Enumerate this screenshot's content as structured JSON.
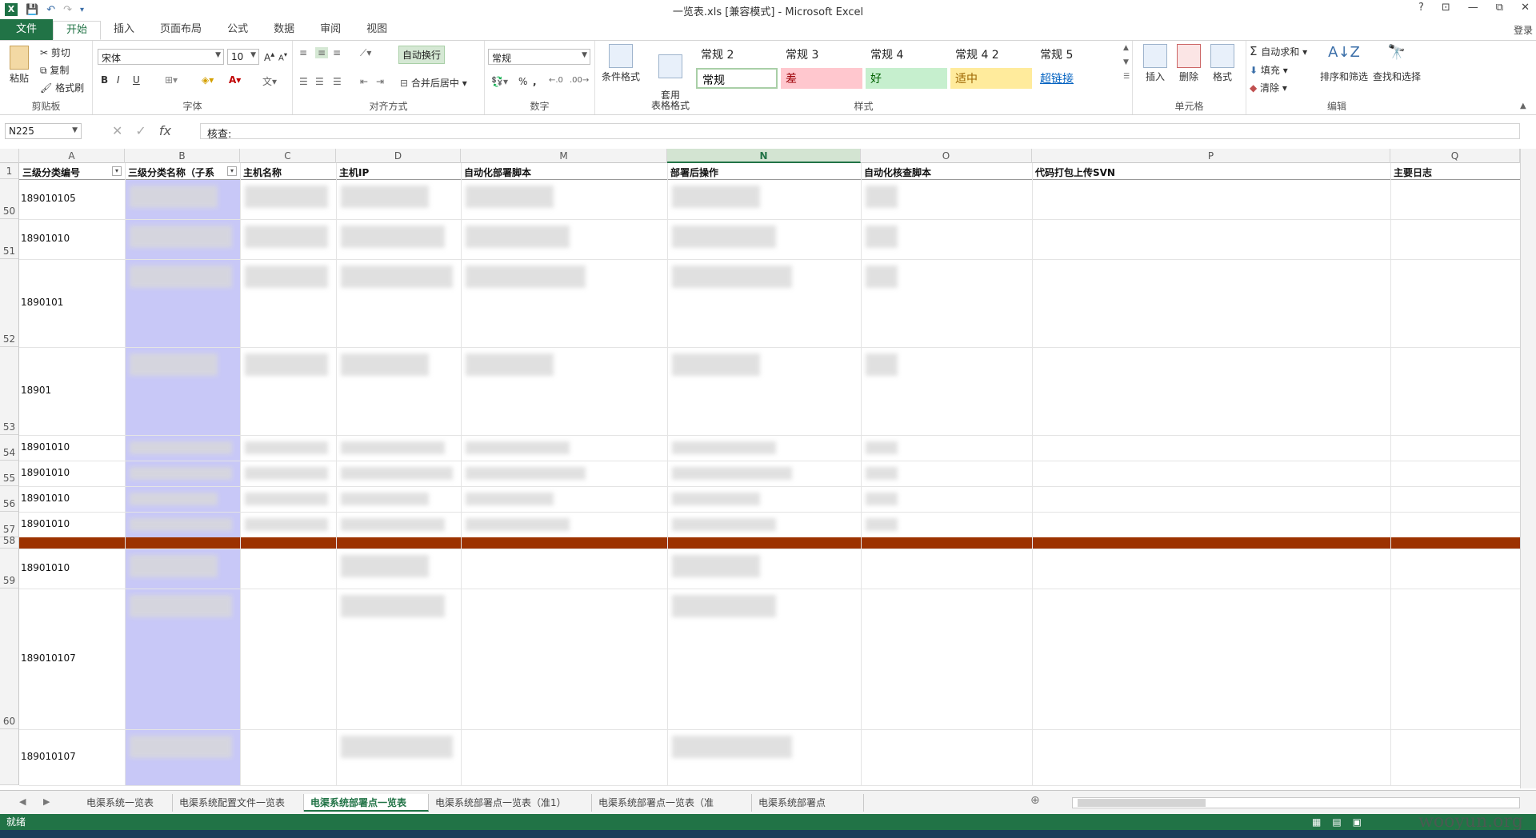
{
  "window": {
    "title": "一览表.xls  [兼容模式] - Microsoft Excel",
    "controls": [
      "?",
      "⊡",
      "—",
      "⧉",
      "✕"
    ],
    "signin": "登录"
  },
  "ribbon_tabs": [
    "文件",
    "开始",
    "插入",
    "页面布局",
    "公式",
    "数据",
    "审阅",
    "视图"
  ],
  "active_tab": "开始",
  "clipboard": {
    "paste": "粘贴",
    "cut": "剪切",
    "copy": "复制",
    "painter": "格式刷",
    "label": "剪贴板"
  },
  "font": {
    "name": "宋体",
    "size": "10",
    "bold": "B",
    "italic": "I",
    "underline": "U",
    "label": "字体"
  },
  "alignment": {
    "wrap": "自动换行",
    "merge": "合并后居中",
    "label": "对齐方式"
  },
  "number": {
    "format": "常规",
    "percent": "%",
    "comma": ",",
    "label": "数字"
  },
  "styles": {
    "conditional": "条件格式",
    "table": "套用\n表格格式",
    "top": [
      "常规 2",
      "常规 3",
      "常规 4",
      "常规 4 2",
      "常规 5"
    ],
    "bottom": [
      {
        "label": "常规",
        "bg": "#ffffff",
        "color": "#000000"
      },
      {
        "label": "差",
        "bg": "#ffc7ce",
        "color": "#9c0006"
      },
      {
        "label": "好",
        "bg": "#c6efce",
        "color": "#006100"
      },
      {
        "label": "适中",
        "bg": "#ffeb9c",
        "color": "#9c6500"
      },
      {
        "label": "超链接",
        "bg": "#ffffff",
        "color": "#0563c1"
      }
    ],
    "label": "样式"
  },
  "cells": {
    "insert": "插入",
    "delete": "删除",
    "format": "格式",
    "label": "单元格"
  },
  "editing": {
    "autosum": "自动求和",
    "fill": "填充",
    "clear": "清除",
    "sort": "排序和筛选",
    "find": "查找和选择",
    "label": "编辑"
  },
  "formula_bar": {
    "name_box": "N225",
    "content": "核查:"
  },
  "columns": [
    {
      "letter": "A",
      "header": "三级分类编号"
    },
    {
      "letter": "B",
      "header": "三级分类名称（子系"
    },
    {
      "letter": "C",
      "header": "主机名称"
    },
    {
      "letter": "D",
      "header": "主机IP"
    },
    {
      "letter": "M",
      "header": "自动化部署脚本"
    },
    {
      "letter": "N",
      "header": "部署后操作"
    },
    {
      "letter": "O",
      "header": "自动化核查脚本"
    },
    {
      "letter": "P",
      "header": "代码打包上传SVN"
    },
    {
      "letter": "Q",
      "header": "主要日志"
    }
  ],
  "active_column": "N",
  "header_row_number": "1",
  "rows": [
    {
      "num": "50",
      "a": "189010105"
    },
    {
      "num": "51",
      "a": "18901010"
    },
    {
      "num": "52",
      "a": "1890101"
    },
    {
      "num": "53",
      "a": "18901"
    },
    {
      "num": "54",
      "a": "18901010"
    },
    {
      "num": "55",
      "a": "18901010"
    },
    {
      "num": "56",
      "a": "18901010"
    },
    {
      "num": "57",
      "a": "18901010"
    },
    {
      "num": "58",
      "a": ""
    },
    {
      "num": "59",
      "a": "18901010"
    },
    {
      "num": "60",
      "a": "189010107"
    },
    {
      "num": "",
      "a": "189010107"
    }
  ],
  "sheet_tabs": [
    "电渠系统一览表",
    "电渠系统配置文件一览表",
    "电渠系统部署点一览表",
    "电渠系统部署点一览表（准1）",
    "电渠系统部署点一览表（准",
    "电渠系统部署点"
  ],
  "active_sheet": "电渠系统部署点一览表",
  "status": {
    "ready": "就绪",
    "watermark": "wooyun.org"
  }
}
